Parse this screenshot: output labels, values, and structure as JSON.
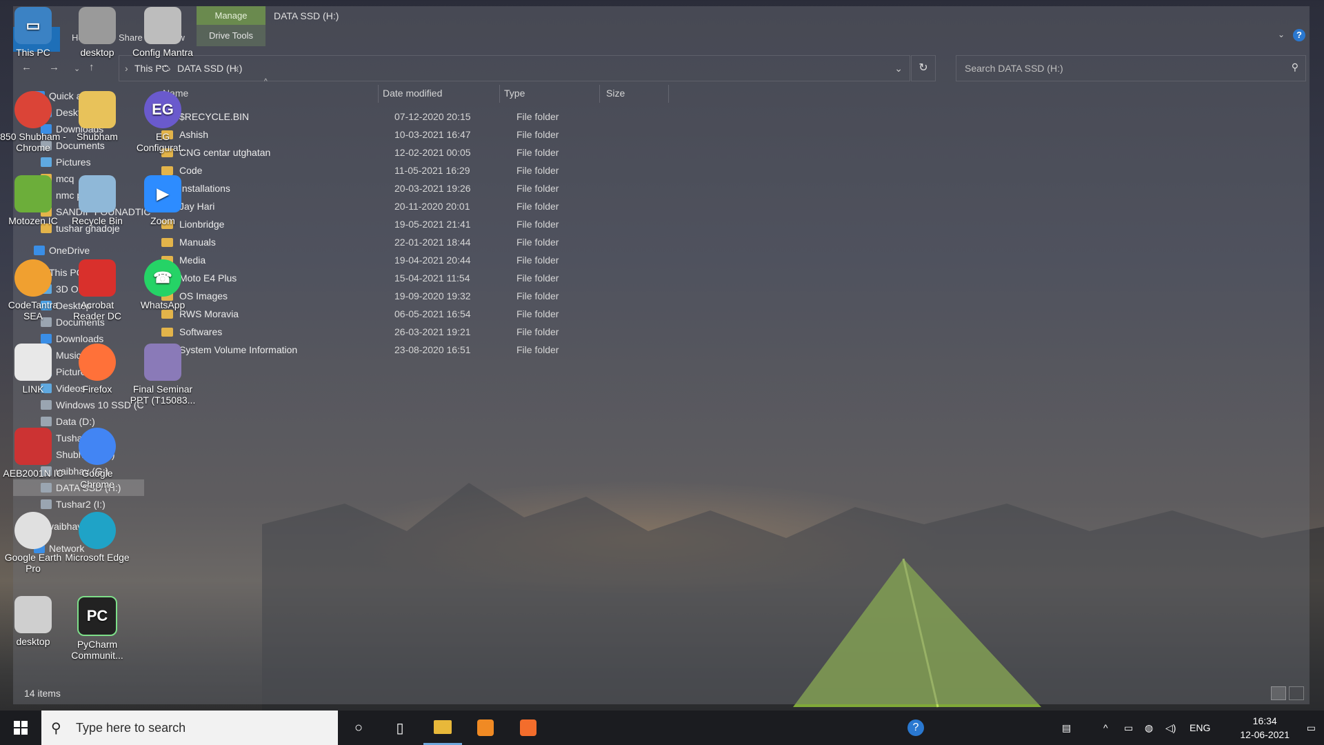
{
  "ribbon": {
    "file": "File",
    "tabs": [
      "Home",
      "Share",
      "View"
    ],
    "manage": "Manage",
    "drive_tools": "Drive Tools",
    "title": "DATA SSD (H:)",
    "help": "?"
  },
  "address": {
    "crumbs": [
      "This PC",
      "DATA SSD (H:)"
    ],
    "search_placeholder": "Search DATA SSD (H:)"
  },
  "nav": {
    "items": [
      {
        "label": "Quick access",
        "color": "#3a8ee6"
      },
      {
        "label": "Desktop",
        "color": "#4aa3e8"
      },
      {
        "label": "Downloads",
        "color": "#3a8ee6"
      },
      {
        "label": "Documents",
        "color": "#9aa5b1"
      },
      {
        "label": "Pictures",
        "color": "#5fa9e0"
      },
      {
        "label": "mcq",
        "color": "#e3b44a"
      },
      {
        "label": "nmc program",
        "color": "#e3b44a"
      },
      {
        "label": "SANDIP FOUNADTIC",
        "color": "#e3b44a"
      },
      {
        "label": "tushar ghadoje",
        "color": "#e3b44a"
      },
      {
        "label": "OneDrive",
        "color": "#3a8ee6"
      },
      {
        "label": "This PC",
        "color": "#5fa9e0"
      },
      {
        "label": "3D Objects",
        "color": "#5fa9e0"
      },
      {
        "label": "Desktop",
        "color": "#4aa3e8"
      },
      {
        "label": "Documents",
        "color": "#9aa5b1"
      },
      {
        "label": "Downloads",
        "color": "#3a8ee6"
      },
      {
        "label": "Music",
        "color": "#3a8ee6"
      },
      {
        "label": "Pictures",
        "color": "#5fa9e0"
      },
      {
        "label": "Videos",
        "color": "#5fa9e0"
      },
      {
        "label": "Windows 10 SSD (C",
        "color": "#9aa5b1"
      },
      {
        "label": "Data (D:)",
        "color": "#9aa5b1"
      },
      {
        "label": "Tushar (E:)",
        "color": "#9aa5b1"
      },
      {
        "label": "Shubham (F:)",
        "color": "#9aa5b1"
      },
      {
        "label": "vaibhav (G:)",
        "color": "#9aa5b1"
      },
      {
        "label": "DATA SSD (H:)",
        "color": "#9aa5b1"
      },
      {
        "label": "Tushar2 (I:)",
        "color": "#9aa5b1"
      },
      {
        "label": "vaibhav (G:)",
        "color": "#9aa5b1"
      },
      {
        "label": "Network",
        "color": "#3a8ee6"
      }
    ]
  },
  "columns": [
    "Name",
    "Date modified",
    "Type",
    "Size"
  ],
  "files": [
    {
      "name": "$RECYCLE.BIN",
      "date": "07-12-2020 20:15",
      "type": "File folder"
    },
    {
      "name": "Ashish",
      "date": "10-03-2021 16:47",
      "type": "File folder"
    },
    {
      "name": "CNG centar utghatan",
      "date": "12-02-2021 00:05",
      "type": "File folder"
    },
    {
      "name": "Code",
      "date": "11-05-2021 16:29",
      "type": "File folder"
    },
    {
      "name": "Installations",
      "date": "20-03-2021 19:26",
      "type": "File folder"
    },
    {
      "name": "Jay Hari",
      "date": "20-11-2020 20:01",
      "type": "File folder"
    },
    {
      "name": "Lionbridge",
      "date": "19-05-2021 21:41",
      "type": "File folder"
    },
    {
      "name": "Manuals",
      "date": "22-01-2021 18:44",
      "type": "File folder"
    },
    {
      "name": "Media",
      "date": "19-04-2021 20:44",
      "type": "File folder"
    },
    {
      "name": "Moto E4 Plus",
      "date": "15-04-2021 11:54",
      "type": "File folder"
    },
    {
      "name": "OS Images",
      "date": "19-09-2020 19:32",
      "type": "File folder"
    },
    {
      "name": "RWS Moravia",
      "date": "06-05-2021 16:54",
      "type": "File folder"
    },
    {
      "name": "Softwares",
      "date": "26-03-2021 19:21",
      "type": "File folder"
    },
    {
      "name": "System Volume Information",
      "date": "23-08-2020 16:51",
      "type": "File folder"
    }
  ],
  "status": "14 items",
  "desktop_icons": [
    {
      "label": "This PC",
      "glyph": "▭",
      "color": "#3b82c4"
    },
    {
      "label": "desktop",
      "glyph": "",
      "color": "#9a9a9a"
    },
    {
      "label": "Config Mantra ...",
      "glyph": "",
      "color": "#bdbdbd"
    },
    {
      "label": "850 Shubham - Chrome",
      "glyph": "",
      "color": "#db4437"
    },
    {
      "label": "Shubham",
      "glyph": "",
      "color": "#e8c25a"
    },
    {
      "label": "EG Configurat...",
      "glyph": "EG",
      "color": "#6a5acd"
    },
    {
      "label": "Motozen IC",
      "glyph": "",
      "color": "#6cae3a"
    },
    {
      "label": "Recycle Bin",
      "glyph": "",
      "color": "#8fb8d8"
    },
    {
      "label": "Zoom",
      "glyph": "▶",
      "color": "#2d8cff"
    },
    {
      "label": "CodeTantra SEA",
      "glyph": "",
      "color": "#f0a030"
    },
    {
      "label": "Acrobat Reader DC",
      "glyph": "",
      "color": "#d9302c"
    },
    {
      "label": "WhatsApp",
      "glyph": "☎",
      "color": "#25d366"
    },
    {
      "label": "LINK",
      "glyph": "",
      "color": "#e8e8e8"
    },
    {
      "label": "Firefox",
      "glyph": "",
      "color": "#ff7139"
    },
    {
      "label": "Final Seminar PPT (T15083...",
      "glyph": "",
      "color": "#8a7ab8"
    },
    {
      "label": "AEB2001N IC",
      "glyph": "",
      "color": "#c33"
    },
    {
      "label": "Google Chrome",
      "glyph": "",
      "color": "#4285f4"
    },
    {
      "label": "Google Earth Pro",
      "glyph": "",
      "color": "#e0e0e0"
    },
    {
      "label": "Microsoft Edge",
      "glyph": "",
      "color": "#1fa3c7"
    },
    {
      "label": "desktop",
      "glyph": "",
      "color": "#cfcfcf"
    },
    {
      "label": "PyCharm Communit...",
      "glyph": "PC",
      "color": "#222"
    }
  ],
  "taskbar": {
    "search_placeholder": "Type here to search",
    "lang": "ENG",
    "time": "16:34",
    "date": "12-06-2021"
  }
}
